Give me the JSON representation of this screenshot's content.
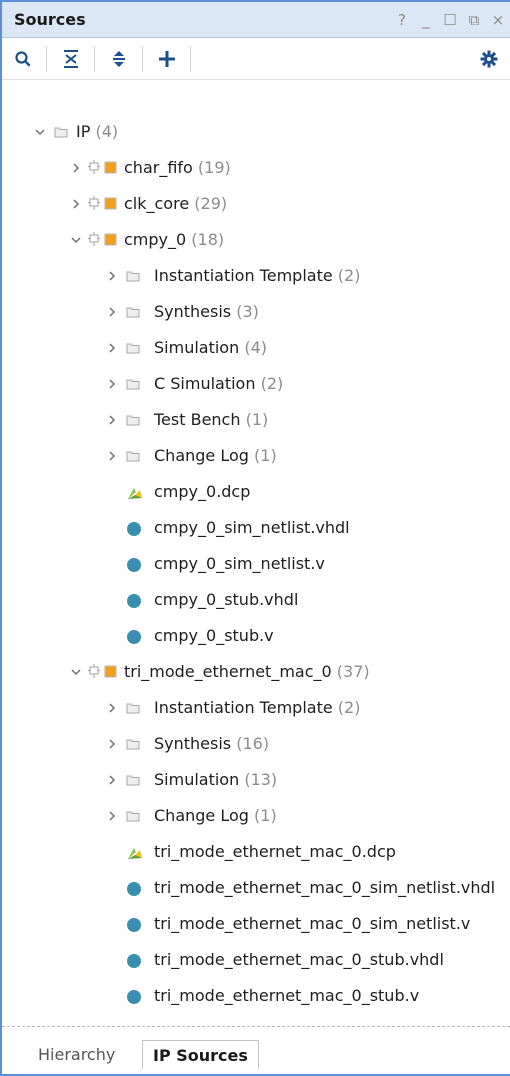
{
  "panel": {
    "title": "Sources",
    "controls": [
      "?",
      "_",
      "☐",
      "⧉",
      "×"
    ]
  },
  "toolbar": {
    "search_icon": "search-icon",
    "collapse_icon": "collapse-all-icon",
    "expand_icon": "expand-all-icon",
    "add_icon": "add-icon",
    "settings_icon": "gear-icon"
  },
  "tree": {
    "root": {
      "label": "IP",
      "count": "(4)"
    },
    "char_fifo": {
      "label": "char_fifo",
      "count": "(19)"
    },
    "clk_core": {
      "label": "clk_core",
      "count": "(29)"
    },
    "cmpy_0": {
      "label": "cmpy_0",
      "count": "(18)",
      "folders": [
        {
          "label": "Instantiation Template",
          "count": "(2)"
        },
        {
          "label": "Synthesis",
          "count": "(3)"
        },
        {
          "label": "Simulation",
          "count": "(4)"
        },
        {
          "label": "C Simulation",
          "count": "(2)"
        },
        {
          "label": "Test Bench",
          "count": "(1)"
        },
        {
          "label": "Change Log",
          "count": "(1)"
        }
      ],
      "files": [
        {
          "label": "cmpy_0.dcp",
          "kind": "dcp"
        },
        {
          "label": "cmpy_0_sim_netlist.vhdl",
          "kind": "hdl"
        },
        {
          "label": "cmpy_0_sim_netlist.v",
          "kind": "hdl"
        },
        {
          "label": "cmpy_0_stub.vhdl",
          "kind": "hdl"
        },
        {
          "label": "cmpy_0_stub.v",
          "kind": "hdl"
        }
      ]
    },
    "tri_mode": {
      "label": "tri_mode_ethernet_mac_0",
      "count": "(37)",
      "folders": [
        {
          "label": "Instantiation Template",
          "count": "(2)"
        },
        {
          "label": "Synthesis",
          "count": "(16)"
        },
        {
          "label": "Simulation",
          "count": "(13)"
        },
        {
          "label": "Change Log",
          "count": "(1)"
        }
      ],
      "files": [
        {
          "label": "tri_mode_ethernet_mac_0.dcp",
          "kind": "dcp"
        },
        {
          "label": "tri_mode_ethernet_mac_0_sim_netlist.vhdl",
          "kind": "hdl"
        },
        {
          "label": "tri_mode_ethernet_mac_0_sim_netlist.v",
          "kind": "hdl"
        },
        {
          "label": "tri_mode_ethernet_mac_0_stub.vhdl",
          "kind": "hdl"
        },
        {
          "label": "tri_mode_ethernet_mac_0_stub.v",
          "kind": "hdl"
        }
      ]
    }
  },
  "tabs": [
    {
      "label": "Hierarchy",
      "active": false
    },
    {
      "label": "IP Sources",
      "active": true
    }
  ],
  "colors": {
    "accent": "#5b8fd6",
    "ip_orange": "#f0a020",
    "hdl_dot": "#3a8fb0",
    "dcp_green": "#8bc34a"
  }
}
